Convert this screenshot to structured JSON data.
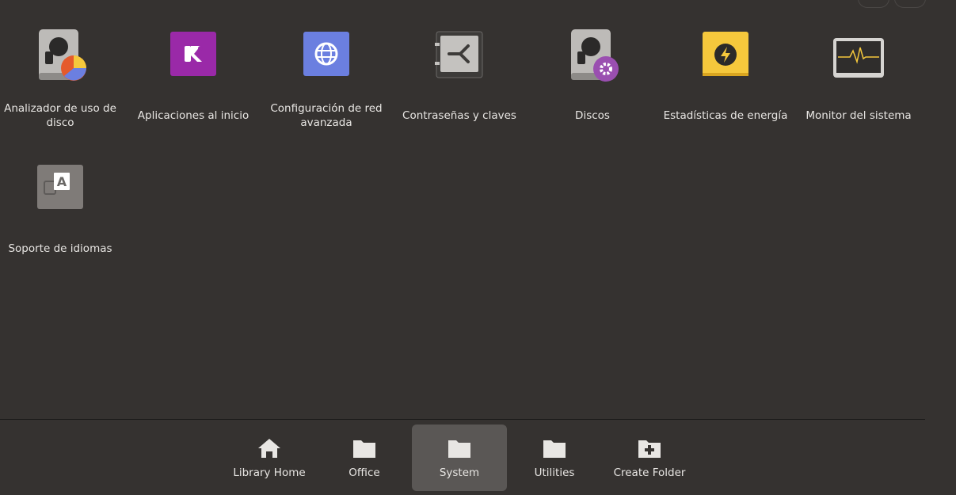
{
  "apps": [
    {
      "label": "Analizador de uso de disco",
      "icon": "disk-usage-analyzer-icon"
    },
    {
      "label": "Aplicaciones al inicio",
      "icon": "startup-applications-icon"
    },
    {
      "label": "Configuración de red avanzada",
      "icon": "advanced-network-icon"
    },
    {
      "label": "Contraseñas y claves",
      "icon": "passwords-keys-icon"
    },
    {
      "label": "Discos",
      "icon": "disks-icon"
    },
    {
      "label": "Estadísticas de energía",
      "icon": "power-statistics-icon"
    },
    {
      "label": "Monitor del sistema",
      "icon": "system-monitor-icon"
    },
    {
      "label": "Soporte de idiomas",
      "icon": "language-support-icon"
    }
  ],
  "tabs": [
    {
      "label": "Library Home",
      "icon": "home-icon"
    },
    {
      "label": "Office",
      "icon": "folder-icon"
    },
    {
      "label": "System",
      "icon": "folder-icon",
      "active": true
    },
    {
      "label": "Utilities",
      "icon": "folder-icon"
    },
    {
      "label": "Create Folder",
      "icon": "create-folder-icon"
    }
  ],
  "colors": {
    "background": "#353230",
    "active_tab": "#5a5755",
    "startup_purple": "#9a29a8",
    "network_blue": "#6b7fe0",
    "energy_yellow": "#f5c83c"
  }
}
